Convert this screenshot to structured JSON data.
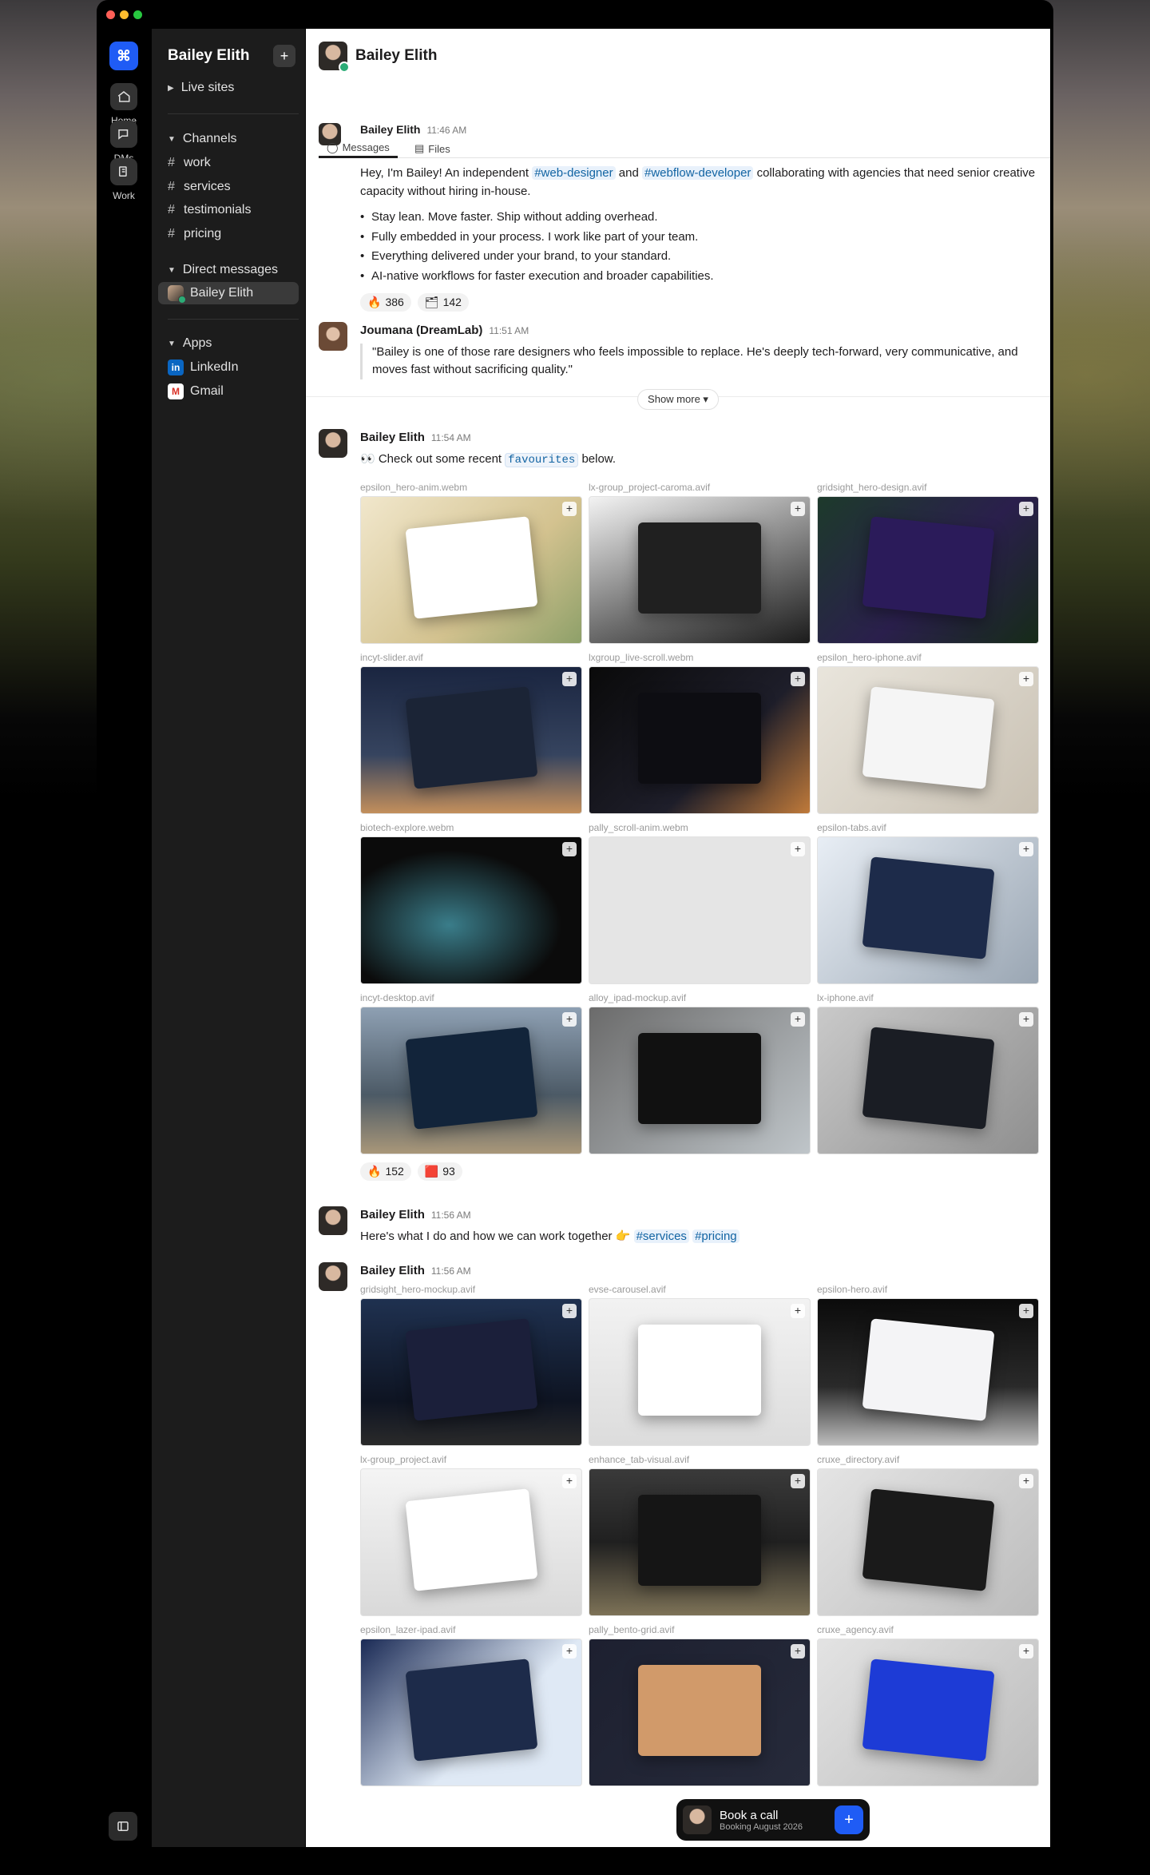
{
  "workspace": {
    "logo_glyph": "⌘",
    "accent": "#1f5cf5"
  },
  "rail": {
    "items": [
      {
        "label": "Home",
        "icon": "home-icon"
      },
      {
        "label": "DMs",
        "icon": "chat-icon"
      },
      {
        "label": "Work",
        "icon": "files-icon"
      }
    ]
  },
  "sidebar": {
    "title": "Bailey Elith",
    "add": "+",
    "live_sites": "Live sites",
    "channels_header": "Channels",
    "channels": [
      "work",
      "services",
      "testimonials",
      "pricing"
    ],
    "dm_header": "Direct messages",
    "dm": "Bailey Elith",
    "apps_header": "Apps",
    "apps": [
      {
        "label": "LinkedIn",
        "glyph": "in"
      },
      {
        "label": "Gmail",
        "glyph": "M"
      }
    ]
  },
  "header": {
    "name": "Bailey Elith"
  },
  "tabs": {
    "author": "Bailey Elith",
    "time": "11:46 AM",
    "messages": "Messages",
    "files": "Files"
  },
  "intro": {
    "pre": "Hey, I'm Bailey! An independent ",
    "tag1": "#web-designer",
    "mid": " and ",
    "tag2": "#webflow-developer",
    "post": " collaborating with agencies that need senior creative capacity without hiring in-house.",
    "bullets": [
      "Stay lean. Move faster. Ship without adding overhead.",
      "Fully embedded in your process. I work like part of your team.",
      "Everything delivered under your brand, to your standard.",
      "AI-native workflows for faster execution and broader capabilities."
    ],
    "reactions": [
      {
        "emoji": "🔥",
        "count": "386"
      },
      {
        "emoji": "🗂",
        "count": "142"
      }
    ]
  },
  "testimonial": {
    "author": "Joumana (DreamLab)",
    "time": "11:51 AM",
    "text": "\"Bailey is one of those rare designers who feels impossible to replace. He's deeply tech-forward, very communicative, and moves fast without sacrificing quality.\""
  },
  "show_more": "Show more",
  "favourites": {
    "author": "Bailey Elith",
    "time": "11:54 AM",
    "pre": "👀 Check out some recent ",
    "tag": "favourites",
    "post": " below.",
    "files": [
      "epsilon_hero-anim.webm",
      "lx-group_project-caroma.avif",
      "gridsight_hero-design.avif",
      "incyt-slider.avif",
      "lxgroup_live-scroll.webm",
      "epsilon_hero-iphone.avif",
      "biotech-explore.webm",
      "pally_scroll-anim.webm",
      "epsilon-tabs.avif",
      "incyt-desktop.avif",
      "alloy_ipad-mockup.avif",
      "lx-iphone.avif"
    ],
    "reactions": [
      {
        "emoji": "🔥",
        "count": "152"
      },
      {
        "emoji": "🟥",
        "count": "93"
      }
    ]
  },
  "services_msg": {
    "author": "Bailey Elith",
    "time": "11:56 AM",
    "text": "Here's what I do and how we can work together 👉",
    "tag1": "#services",
    "tag2": "#pricing"
  },
  "gallery2": {
    "author": "Bailey Elith",
    "time": "11:56 AM",
    "files": [
      "gridsight_hero-mockup.avif",
      "evse-carousel.avif",
      "epsilon-hero.avif",
      "lx-group_project.avif",
      "enhance_tab-visual.avif",
      "cruxe_directory.avif",
      "epsilon_lazer-ipad.avif",
      "pally_bento-grid.avif",
      "cruxe_agency.avif"
    ]
  },
  "book": {
    "title": "Book a call",
    "subtitle": "Booking August 2026",
    "button": "+"
  }
}
